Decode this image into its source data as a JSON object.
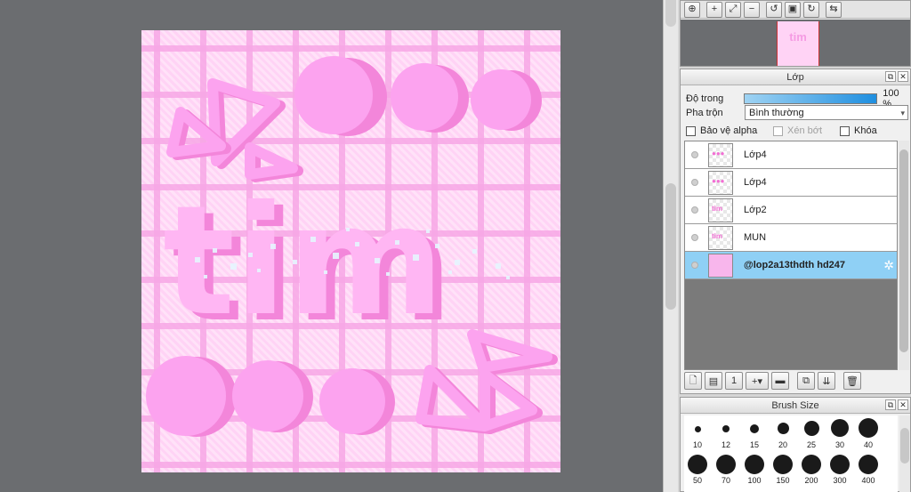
{
  "canvas": {
    "art_text": "tim",
    "colors": {
      "bg": "#ffd3f5",
      "grid": "#f7a7e5",
      "shape": "#fca3ef",
      "shadow": "#f386da",
      "text": "#ffb6f3",
      "sparkle": "#d9f0ff"
    }
  },
  "navigator": {
    "tools": [
      "zoom-in-icon",
      "zoom-plus-icon",
      "fit-icon",
      "zoom-minus-icon",
      "rotate-left-icon",
      "fit-window-icon",
      "rotate-right-icon",
      "flip-icon"
    ]
  },
  "layer_panel": {
    "title": "Lớp",
    "opacity_label": "Độ trong",
    "opacity_value": "100 %",
    "opacity_fraction": 1.0,
    "blend_label": "Pha trộn",
    "blend_value": "Bình thường",
    "protect_alpha_label": "Bảo vệ alpha",
    "clipping_label": "Xén bớt",
    "lock_label": "Khóa",
    "layers": [
      {
        "name": "Lớp4",
        "selected": false
      },
      {
        "name": "Lớp4",
        "selected": false
      },
      {
        "name": "Lớp2",
        "selected": false
      },
      {
        "name": "MUN",
        "selected": false
      },
      {
        "name": "@lop2a13thdth  hd247",
        "selected": true
      }
    ]
  },
  "brush_panel": {
    "title": "Brush Size",
    "sizes": [
      "10",
      "12",
      "15",
      "20",
      "25",
      "30",
      "40",
      "50",
      "70",
      "100",
      "150",
      "200",
      "300",
      "400"
    ]
  },
  "accent_color": "#8fd0f5"
}
